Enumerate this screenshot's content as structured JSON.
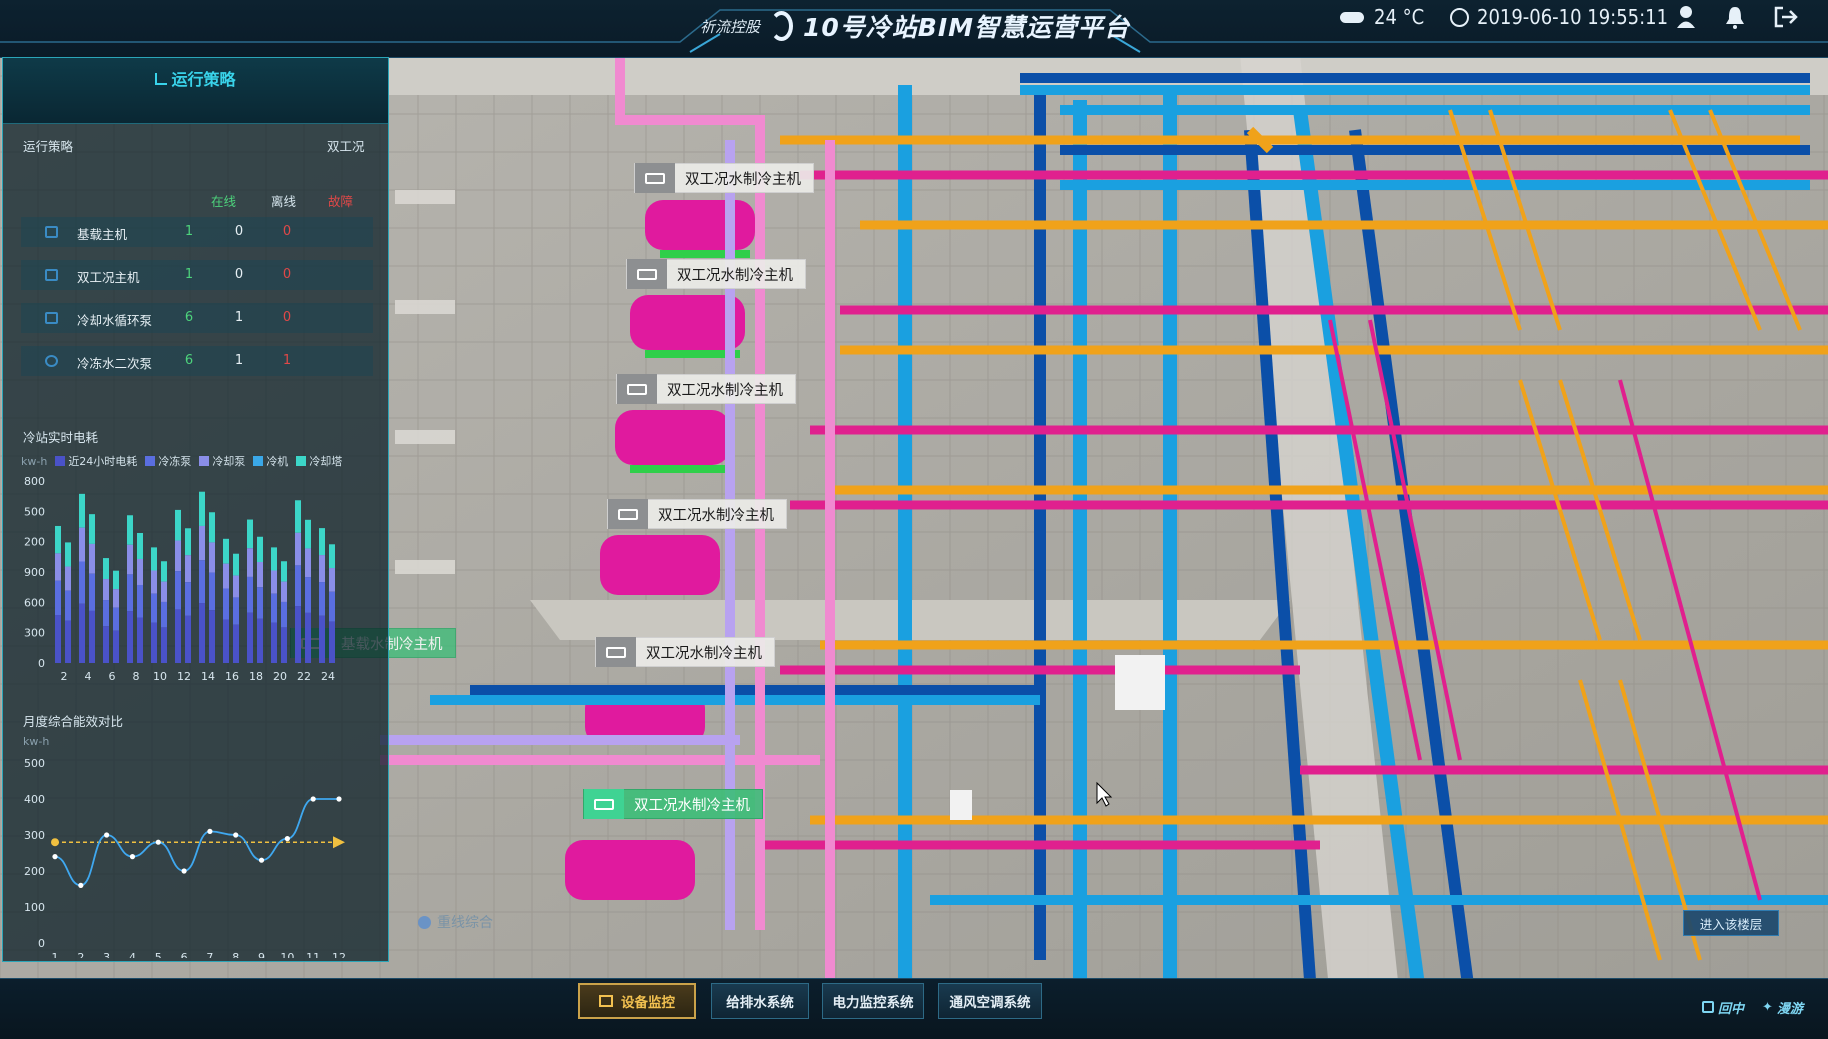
{
  "header": {
    "brand_logo_text": "祈流控股",
    "title": "10号冷站BIM智慧运营平台",
    "weather": "24 °C",
    "datetime": "2019-06-10  19:55:11"
  },
  "panel": {
    "title": "运行策略",
    "strategy_label": "运行策略",
    "strategy_value": "双工况",
    "columns": {
      "online": "在线",
      "offline": "离线",
      "fault": "故障"
    },
    "rows": [
      {
        "label": "基载主机",
        "online": "1",
        "offline": "0",
        "fault": "0"
      },
      {
        "label": "双工况主机",
        "online": "1",
        "offline": "0",
        "fault": "0"
      },
      {
        "label": "冷却水循环泵",
        "online": "6",
        "offline": "1",
        "fault": "0"
      },
      {
        "label": "冷冻水二次泵",
        "online": "6",
        "offline": "1",
        "fault": "1"
      }
    ],
    "realtime_title": "冷站实时电耗",
    "realtime_unit": "kw-h",
    "legend": [
      "近24小时电耗",
      "冷冻泵",
      "冷却泵",
      "冷机",
      "冷却塔"
    ],
    "legend_colors": [
      "#4a52c8",
      "#5a6ee0",
      "#8a8ee8",
      "#3aa8e8",
      "#3cd6c8"
    ],
    "monthly_title": "月度综合能效对比",
    "monthly_unit": "kw-h"
  },
  "chart_data": [
    {
      "type": "bar",
      "title": "冷站实时电耗",
      "ylabel": "kw-h",
      "yticks": [
        "800",
        "500",
        "200",
        "900",
        "600",
        "300",
        "0"
      ],
      "categories": [
        "2",
        "4",
        "6",
        "8",
        "10",
        "12",
        "14",
        "16",
        "18",
        "20",
        "22",
        "24"
      ],
      "values": [
        640,
        790,
        490,
        690,
        540,
        715,
        800,
        580,
        670,
        540,
        760,
        630
      ]
    },
    {
      "type": "line",
      "title": "月度综合能效对比",
      "ylabel": "kw-h",
      "ylim": [
        0,
        500
      ],
      "yticks": [
        "500",
        "400",
        "300",
        "200",
        "100",
        "0"
      ],
      "x": [
        "1",
        "2",
        "3",
        "4",
        "5",
        "6",
        "7",
        "8",
        "9",
        "10",
        "11",
        "12"
      ],
      "series": [
        {
          "values": [
            240,
            160,
            300,
            240,
            280,
            200,
            310,
            300,
            230,
            290,
            400,
            400
          ]
        },
        {
          "values": [
            280,
            280,
            280,
            280,
            280,
            280,
            280,
            280,
            280,
            280,
            280,
            280
          ]
        }
      ]
    }
  ],
  "devices": [
    {
      "label": "双工况水制冷主机"
    },
    {
      "label": "双工况水制冷主机"
    },
    {
      "label": "双工况水制冷主机"
    },
    {
      "label": "双工况水制冷主机"
    },
    {
      "label": "双工况水制冷主机"
    },
    {
      "label": "双工况水制冷主机"
    },
    {
      "label": "基载水制冷主机"
    }
  ],
  "scene_labels": {
    "overlay_faded": "重线综合"
  },
  "enter_floor": "进入该楼层",
  "nav": [
    {
      "label": "设备监控"
    },
    {
      "label": "给排水系统"
    },
    {
      "label": "电力监控系统"
    },
    {
      "label": "通风空调系统"
    }
  ],
  "view_controls": {
    "reset": "回中",
    "roam": "漫游"
  }
}
